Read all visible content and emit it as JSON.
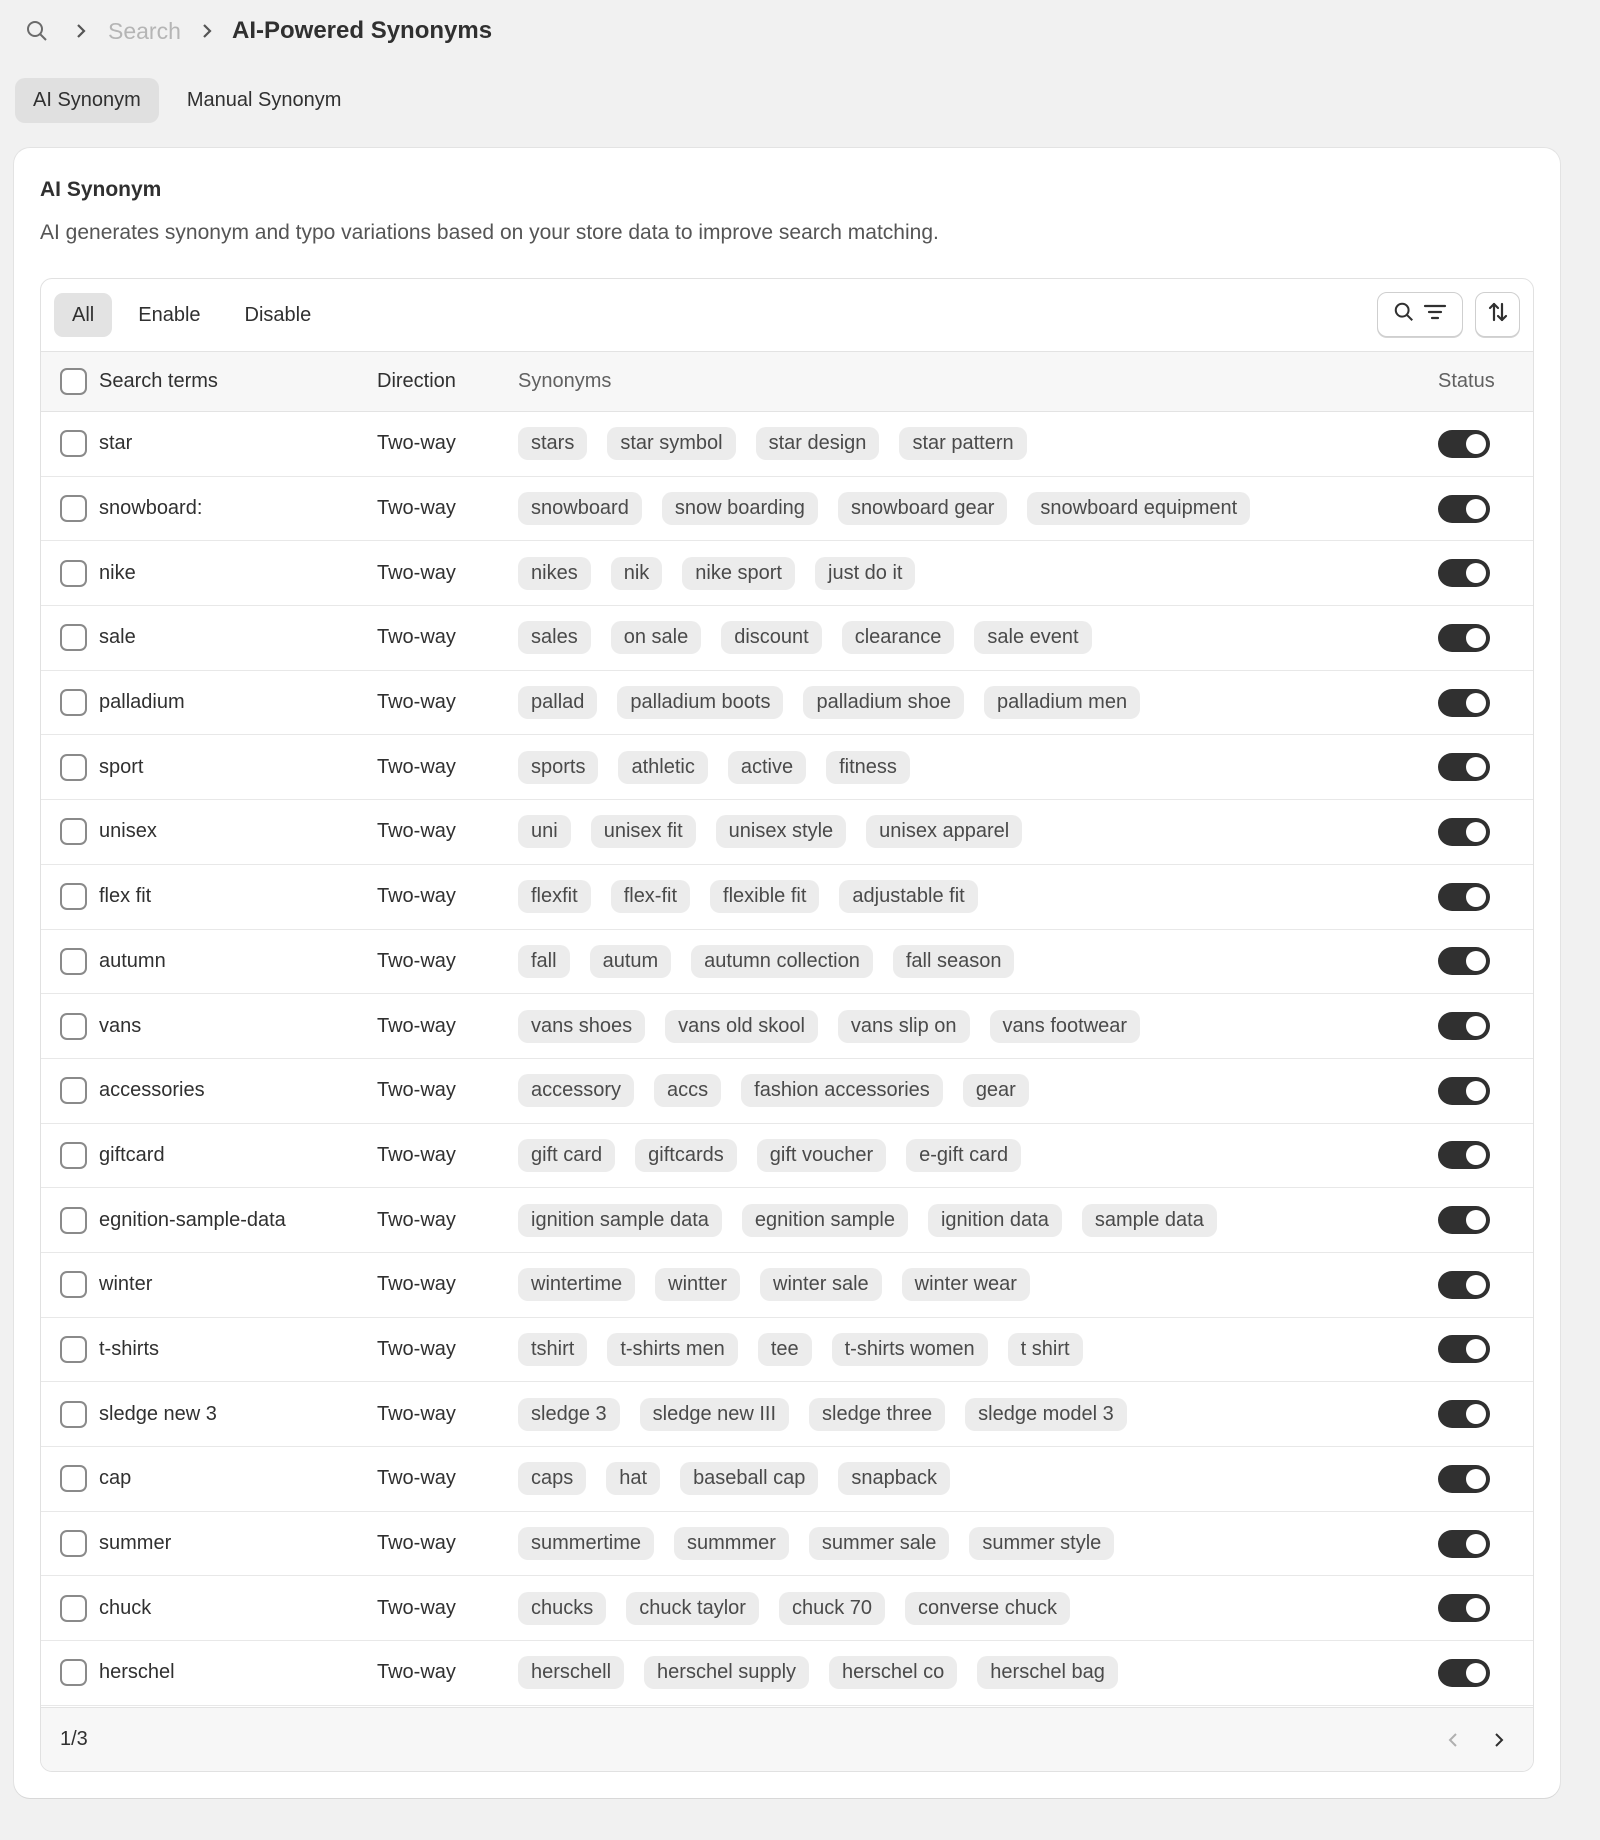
{
  "breadcrumb": {
    "search_link": "Search",
    "title": "AI-Powered Synonyms"
  },
  "tabs": [
    {
      "label": "AI Synonym",
      "active": true
    },
    {
      "label": "Manual Synonym",
      "active": false
    }
  ],
  "card": {
    "title": "AI Synonym",
    "description": "AI generates synonym and typo variations based on your store data to improve search matching."
  },
  "filters": [
    {
      "label": "All",
      "active": true
    },
    {
      "label": "Enable",
      "active": false
    },
    {
      "label": "Disable",
      "active": false
    }
  ],
  "table": {
    "headers": {
      "term": "Search terms",
      "direction": "Direction",
      "synonyms": "Synonyms",
      "status": "Status"
    },
    "rows": [
      {
        "term": "star",
        "direction": "Two-way",
        "synonyms": [
          "stars",
          "star symbol",
          "star design",
          "star pattern"
        ],
        "enabled": true
      },
      {
        "term": "snowboard:",
        "direction": "Two-way",
        "synonyms": [
          "snowboard",
          "snow boarding",
          "snowboard gear",
          "snowboard equipment"
        ],
        "enabled": true
      },
      {
        "term": "nike",
        "direction": "Two-way",
        "synonyms": [
          "nikes",
          "nik",
          "nike sport",
          "just do it"
        ],
        "enabled": true
      },
      {
        "term": "sale",
        "direction": "Two-way",
        "synonyms": [
          "sales",
          "on sale",
          "discount",
          "clearance",
          "sale event"
        ],
        "enabled": true
      },
      {
        "term": "palladium",
        "direction": "Two-way",
        "synonyms": [
          "pallad",
          "palladium boots",
          "palladium shoe",
          "palladium men"
        ],
        "enabled": true
      },
      {
        "term": "sport",
        "direction": "Two-way",
        "synonyms": [
          "sports",
          "athletic",
          "active",
          "fitness"
        ],
        "enabled": true
      },
      {
        "term": "unisex",
        "direction": "Two-way",
        "synonyms": [
          "uni",
          "unisex fit",
          "unisex style",
          "unisex apparel"
        ],
        "enabled": true
      },
      {
        "term": "flex fit",
        "direction": "Two-way",
        "synonyms": [
          "flexfit",
          "flex-fit",
          "flexible fit",
          "adjustable fit"
        ],
        "enabled": true
      },
      {
        "term": "autumn",
        "direction": "Two-way",
        "synonyms": [
          "fall",
          "autum",
          "autumn collection",
          "fall season"
        ],
        "enabled": true
      },
      {
        "term": "vans",
        "direction": "Two-way",
        "synonyms": [
          "vans shoes",
          "vans old skool",
          "vans slip on",
          "vans footwear"
        ],
        "enabled": true
      },
      {
        "term": "accessories",
        "direction": "Two-way",
        "synonyms": [
          "accessory",
          "accs",
          "fashion accessories",
          "gear"
        ],
        "enabled": true
      },
      {
        "term": "giftcard",
        "direction": "Two-way",
        "synonyms": [
          "gift card",
          "giftcards",
          "gift voucher",
          "e-gift card"
        ],
        "enabled": true
      },
      {
        "term": "egnition-sample-data",
        "direction": "Two-way",
        "synonyms": [
          "ignition sample data",
          "egnition sample",
          "ignition data",
          "sample data"
        ],
        "enabled": true
      },
      {
        "term": "winter",
        "direction": "Two-way",
        "synonyms": [
          "wintertime",
          "wintter",
          "winter sale",
          "winter wear"
        ],
        "enabled": true
      },
      {
        "term": "t-shirts",
        "direction": "Two-way",
        "synonyms": [
          "tshirt",
          "t-shirts men",
          "tee",
          "t-shirts women",
          "t shirt"
        ],
        "enabled": true
      },
      {
        "term": "sledge new 3",
        "direction": "Two-way",
        "synonyms": [
          "sledge 3",
          "sledge new III",
          "sledge three",
          "sledge model 3"
        ],
        "enabled": true
      },
      {
        "term": "cap",
        "direction": "Two-way",
        "synonyms": [
          "caps",
          "hat",
          "baseball cap",
          "snapback"
        ],
        "enabled": true
      },
      {
        "term": "summer",
        "direction": "Two-way",
        "synonyms": [
          "summertime",
          "summmer",
          "summer sale",
          "summer style"
        ],
        "enabled": true
      },
      {
        "term": "chuck",
        "direction": "Two-way",
        "synonyms": [
          "chucks",
          "chuck taylor",
          "chuck 70",
          "converse chuck"
        ],
        "enabled": true
      },
      {
        "term": "herschel",
        "direction": "Two-way",
        "synonyms": [
          "herschell",
          "herschel supply",
          "herschel co",
          "herschel bag"
        ],
        "enabled": true
      }
    ]
  },
  "pagination": {
    "label": "1/3"
  },
  "icons": {
    "search": "search-icon",
    "chevron": "chevron-right-icon",
    "filter": "filter-icon",
    "sort": "sort-icon"
  }
}
